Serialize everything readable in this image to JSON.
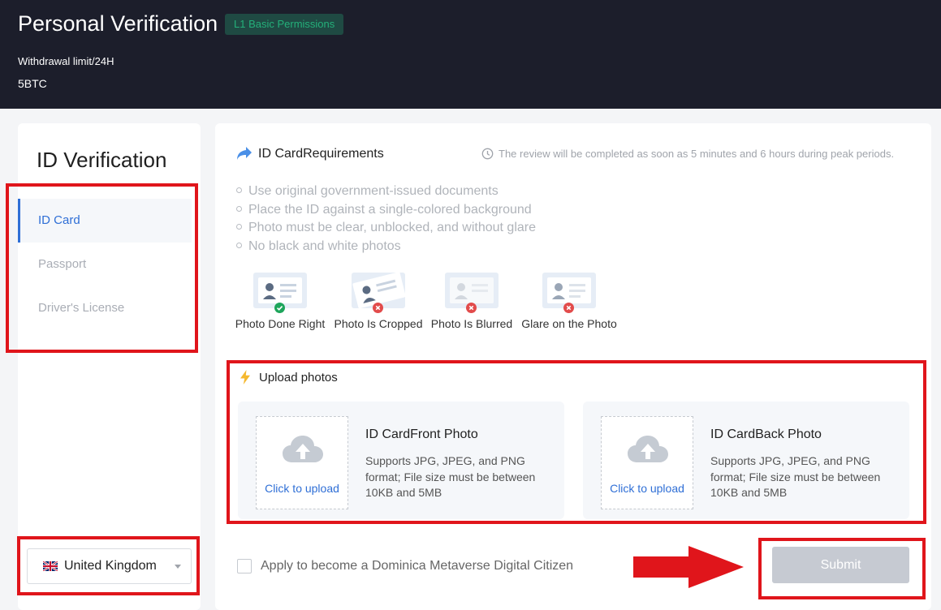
{
  "header": {
    "title": "Personal Verification",
    "badge": "L1 Basic Permissions",
    "limit_label": "Withdrawal limit/24H",
    "limit_value": "5BTC"
  },
  "sidebar": {
    "title": "ID Verification",
    "items": [
      {
        "label": "ID Card",
        "active": true
      },
      {
        "label": "Passport",
        "active": false
      },
      {
        "label": "Driver's License",
        "active": false
      }
    ],
    "country": {
      "label": "United Kingdom",
      "flag": "uk-flag-icon"
    }
  },
  "requirements": {
    "title": "ID CardRequirements",
    "review_note": "The review will be completed as soon as 5 minutes and 6 hours during peak periods.",
    "items": [
      "Use original government-issued documents",
      "Place the ID against a single-colored background",
      "Photo must be clear, unblocked, and without glare",
      "No black and white photos"
    ],
    "examples": [
      {
        "label": "Photo Done Right",
        "status": "ok"
      },
      {
        "label": "Photo Is Cropped",
        "status": "bad"
      },
      {
        "label": "Photo Is Blurred",
        "status": "bad"
      },
      {
        "label": "Glare on the Photo",
        "status": "bad"
      }
    ]
  },
  "upload": {
    "title": "Upload photos",
    "front": {
      "title": "ID CardFront Photo",
      "desc": "Supports JPG, JPEG, and PNG format; File size must be between 10KB and 5MB",
      "cta": "Click to upload"
    },
    "back": {
      "title": "ID CardBack Photo",
      "desc": "Supports JPG, JPEG, and PNG format; File size must be between 10KB and 5MB",
      "cta": "Click to upload"
    }
  },
  "citizen_checkbox": {
    "label": "Apply to become a Dominica Metaverse Digital Citizen",
    "checked": false
  },
  "submit": {
    "label": "Submit",
    "enabled": false
  },
  "colors": {
    "accent": "#2f6fd6",
    "highlight": "#e0151b",
    "header_bg": "#1c1e2b",
    "badge_text": "#24b07a"
  }
}
